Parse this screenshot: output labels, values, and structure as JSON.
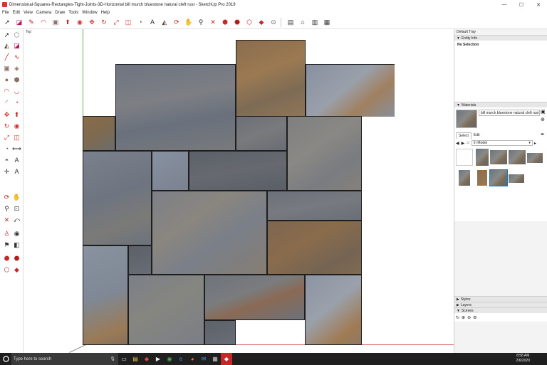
{
  "window": {
    "title": "Dimensional-Squares-Rectangles-Tight-Joints-3D-Horizontal bill murch bluestone natural cleft rust - SketchUp Pro 2019",
    "minimize": "—",
    "maximize": "☐",
    "close": "✕"
  },
  "menu": [
    "File",
    "Edit",
    "View",
    "Camera",
    "Draw",
    "Tools",
    "Window",
    "Help"
  ],
  "viewport": {
    "label": "Top"
  },
  "tray": {
    "title": "Default Tray",
    "entity_info": {
      "header": "Entity Info",
      "value": "No Selection"
    },
    "materials": {
      "header": "Materials",
      "material_name": "bill murch bluestone natural cleft rust",
      "tab_select": "Select",
      "tab_edit": "Edit",
      "collection": "In Model"
    },
    "styles": "Styles",
    "layers": "Layers",
    "scenes": "Scenes"
  },
  "taskbar": {
    "search_placeholder": "Type here to search",
    "time": "8:58 AM",
    "date": "2/6/2020"
  },
  "colors": {
    "accent": "#0078d7",
    "slate": "#6c7480",
    "rust": "#8c6a48"
  }
}
